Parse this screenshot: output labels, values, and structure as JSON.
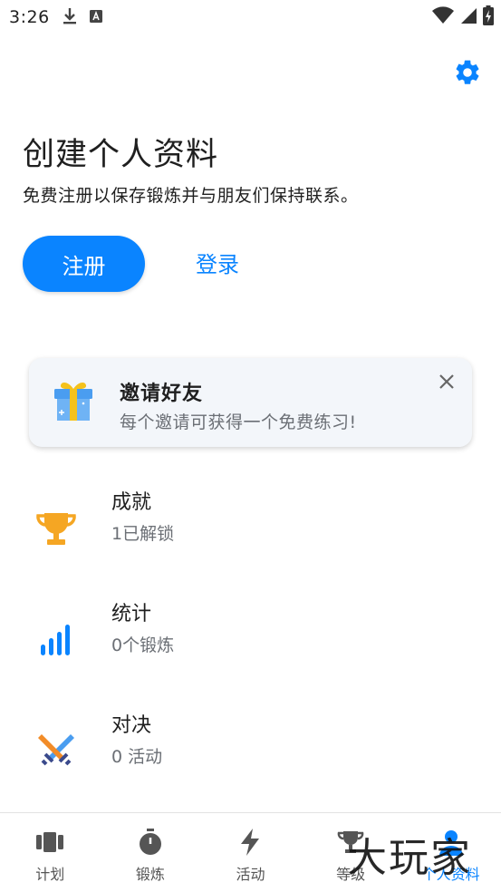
{
  "status_bar": {
    "time": "3:26",
    "left_icons": [
      "download-icon",
      "keyboard-a-icon"
    ],
    "right_icons": [
      "wifi-icon",
      "signal-icon",
      "battery-charging-icon"
    ]
  },
  "header": {
    "settings_icon": "gear-icon",
    "title": "创建个人资料",
    "subtitle": "免费注册以保存锻炼并与朋友们保持联系。"
  },
  "actions": {
    "register_label": "注册",
    "login_label": "登录"
  },
  "invite_card": {
    "icon": "gift-icon",
    "title": "邀请好友",
    "subtitle": "每个邀请可获得一个免费练习!",
    "close_icon": "close-icon"
  },
  "list": [
    {
      "icon": "trophy-icon",
      "title": "成就",
      "subtitle": "1已解锁"
    },
    {
      "icon": "bar-chart-icon",
      "title": "统计",
      "subtitle": "0个锻炼"
    },
    {
      "icon": "crossed-swords-icon",
      "title": "对决",
      "subtitle": "0 活动"
    }
  ],
  "bottom_nav": {
    "items": [
      {
        "label": "计划",
        "icon": "plan-icon"
      },
      {
        "label": "锻炼",
        "icon": "stopwatch-icon"
      },
      {
        "label": "活动",
        "icon": "lightning-icon"
      },
      {
        "label": "等级",
        "icon": "trophy-icon"
      },
      {
        "label": "个人资料",
        "icon": "person-icon",
        "active": true
      }
    ]
  },
  "watermark": "大玩家",
  "colors": {
    "accent": "#0a84ff",
    "trophy": "#f5a623",
    "text_secondary": "#6b6f75"
  }
}
